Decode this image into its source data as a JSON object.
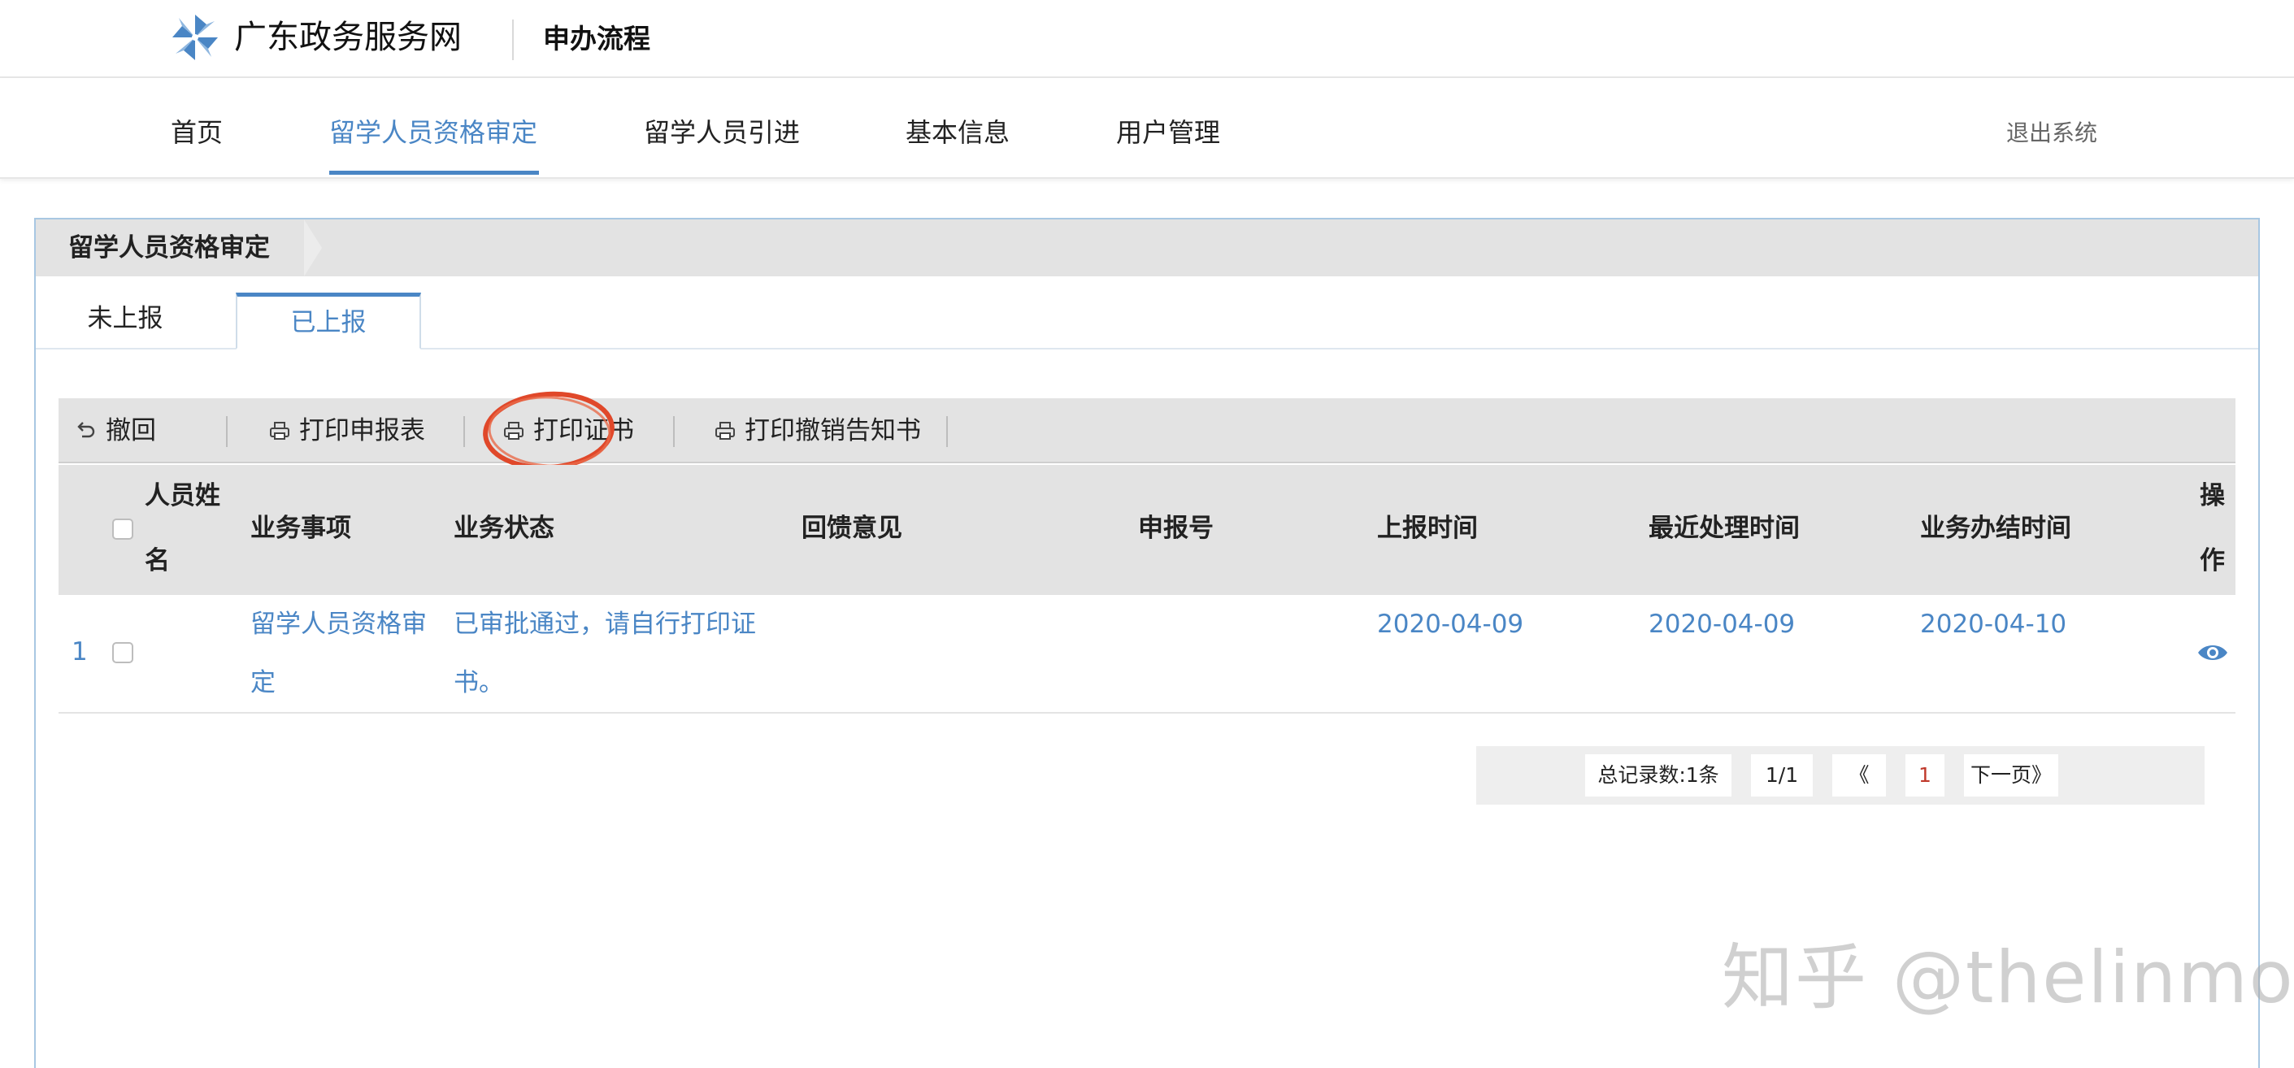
{
  "header": {
    "brand": "广东政务服务网",
    "subtitle": "申办流程",
    "logo_icon": "pinwheel-logo-icon"
  },
  "nav": {
    "items": [
      {
        "label": "首页",
        "active": false
      },
      {
        "label": "留学人员资格审定",
        "active": true
      },
      {
        "label": "留学人员引进",
        "active": false
      },
      {
        "label": "基本信息",
        "active": false
      },
      {
        "label": "用户管理",
        "active": false
      }
    ],
    "logout_label": "退出系统"
  },
  "panel": {
    "title": "留学人员资格审定",
    "tabs": [
      {
        "label": "未上报",
        "active": false
      },
      {
        "label": "已上报",
        "active": true
      }
    ]
  },
  "toolbar": {
    "buttons": [
      {
        "label": "撤回",
        "icon": "undo-icon"
      },
      {
        "label": "打印申报表",
        "icon": "printer-icon"
      },
      {
        "label": "打印证书",
        "icon": "printer-icon",
        "highlighted": true
      },
      {
        "label": "打印撤销告知书",
        "icon": "printer-icon"
      }
    ]
  },
  "table": {
    "columns": {
      "name_line1": "人员姓",
      "name_line2": "名",
      "item": "业务事项",
      "status": "业务状态",
      "feedback": "回馈意见",
      "report_no": "申报号",
      "submit_time": "上报时间",
      "recent_time": "最近处理时间",
      "complete_time": "业务办结时间",
      "action_line1": "操",
      "action_line2": "作"
    },
    "rows": [
      {
        "index": "1",
        "name": "",
        "item_line1": "留学人员资格审",
        "item_line2": "定",
        "status_line1": "已审批通过，请自行打印证",
        "status_line2": "书。",
        "feedback": "",
        "report_no": "",
        "submit_time": "2020-04-09",
        "recent_time": "2020-04-09",
        "complete_time": "2020-04-10",
        "action_icon": "eye-icon"
      }
    ]
  },
  "pagination": {
    "total": "总记录数:1条",
    "page_info": "1/1",
    "prev": "《",
    "current": "1",
    "next": "下一页》"
  },
  "watermark": "知乎 @thelinmo",
  "colors": {
    "accent": "#4a86c5",
    "header_gray": "#e3e3e3",
    "highlight_red": "#e0482a",
    "current_page": "#c0392b"
  }
}
